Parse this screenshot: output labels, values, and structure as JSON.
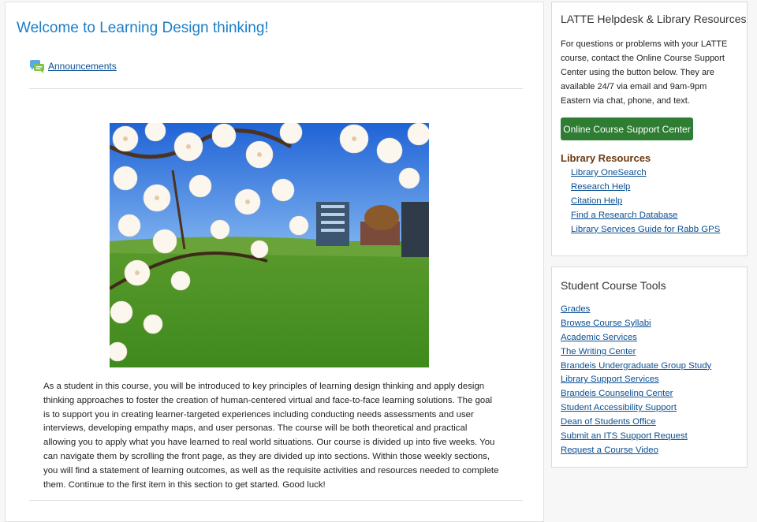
{
  "main": {
    "title": "Welcome to Learning Design thinking!",
    "announcements_label": "Announcements",
    "description": "As a student in this course, you will be introduced to key principles of learning design thinking and apply design thinking approaches to foster the creation of human-centered virtual and face-to-face learning solutions. The goal is to support you in creating learner-targeted experiences including conducting needs assessments and user interviews, developing empathy maps, and user personas. The course will be both theoretical and practical allowing you to apply what you have learned to real world situations. Our course is divided up into five weeks. You can navigate them by scrolling the front page, as they are divided up into sections. Within those weekly sections, you will find a statement of learning outcomes, as well as the requisite activities and resources needed to complete them. Continue to the first item in this section to get started. Good luck!"
  },
  "helpdesk": {
    "title": "LATTE Helpdesk & Library Resources",
    "text": "For questions or problems with your LATTE course, contact the Online Course Support Center using the button below. They are available 24/7 via email and 9am-9pm Eastern via chat, phone, and text.",
    "button_label": "Online Course Support Center",
    "library_heading": "Library Resources",
    "library_links": [
      "Library OneSearch",
      "Research Help",
      "Citation Help",
      "Find a Research Database",
      "Library Services Guide for Rabb GPS"
    ]
  },
  "tools": {
    "title": "Student Course Tools",
    "links": [
      "Grades",
      "Browse Course Syllabi",
      "Academic Services",
      "The Writing Center",
      "Brandeis Undergraduate Group Study",
      "Library Support Services",
      "Brandeis Counseling Center",
      "Student Accessibility Support",
      "Dean of Students Office",
      "Submit an ITS Support Request",
      "Request a Course Video"
    ]
  },
  "colors": {
    "title_blue": "#1a7ec8",
    "link_blue": "#0b4f91",
    "button_green": "#2e7d32",
    "library_brown": "#6b3a12"
  }
}
